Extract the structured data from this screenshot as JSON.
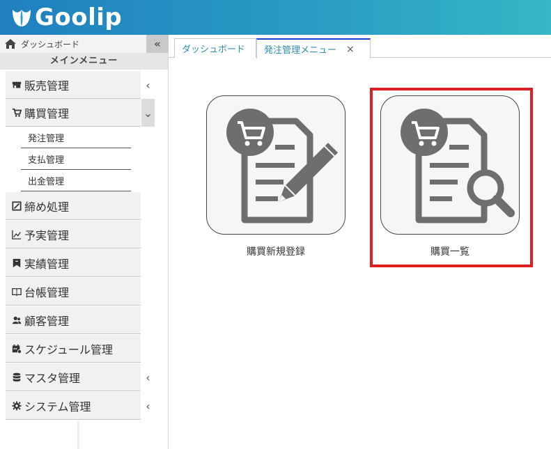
{
  "app": {
    "logo_text": "Goolip"
  },
  "sidebar": {
    "dashboard_label": "ダッシュボード",
    "collapse_symbol": "«",
    "main_menu_label": "メインメニュー",
    "items": [
      {
        "label": "販売管理",
        "icon": "store-icon",
        "chevron": "‹"
      },
      {
        "label": "購買管理",
        "icon": "cart-icon",
        "chevron": "⌄"
      },
      {
        "label": "締め処理",
        "icon": "closing-icon"
      },
      {
        "label": "予実管理",
        "icon": "chart-line-icon"
      },
      {
        "label": "実績管理",
        "icon": "bookmark-icon"
      },
      {
        "label": "台帳管理",
        "icon": "book-icon"
      },
      {
        "label": "顧客管理",
        "icon": "users-icon"
      },
      {
        "label": "スケジュール管理",
        "icon": "calendar-icon"
      },
      {
        "label": "マスタ管理",
        "icon": "database-icon",
        "chevron": "‹"
      },
      {
        "label": "システム管理",
        "icon": "gear-icon",
        "chevron": "‹"
      }
    ],
    "sub_items": [
      {
        "label": "発注管理"
      },
      {
        "label": "支払管理"
      },
      {
        "label": "出金管理"
      }
    ]
  },
  "tabs": [
    {
      "label": "ダッシュボード"
    },
    {
      "label": "発注管理メニュー",
      "close": "×"
    }
  ],
  "tiles": [
    {
      "label": "購買新規登録",
      "icon": "cart-document-edit-icon"
    },
    {
      "label": "購買一覧",
      "icon": "cart-document-search-icon"
    }
  ],
  "colors": {
    "header_start": "#1f7fc0",
    "header_end": "#35b7c6",
    "highlight": "#e02020",
    "tab_active_border": "#1a3fd6"
  }
}
